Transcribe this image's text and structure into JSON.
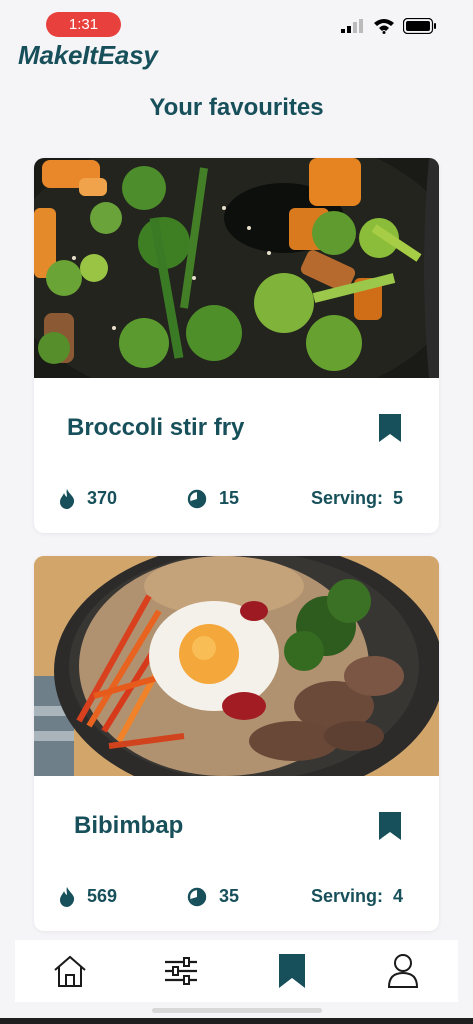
{
  "status_bar": {
    "time": "1:31"
  },
  "app": {
    "brand": "MakeItEasy"
  },
  "page": {
    "title": "Your favourites"
  },
  "recipes": [
    {
      "name": "Broccoli stir fry",
      "calories": "370",
      "time": "15",
      "serving_label": "Serving:",
      "serving": "5",
      "image": "broccoli-stir-fry-photo",
      "bookmarked": true
    },
    {
      "name": "Bibimbap",
      "calories": "569",
      "time": "35",
      "serving_label": "Serving:",
      "serving": "4",
      "image": "bibimbap-photo",
      "bookmarked": true
    }
  ],
  "bottom_nav": {
    "items": [
      {
        "icon": "home-icon",
        "active": false
      },
      {
        "icon": "filters-icon",
        "active": false
      },
      {
        "icon": "bookmark-icon",
        "active": true
      },
      {
        "icon": "profile-icon",
        "active": false
      }
    ]
  },
  "colors": {
    "primary": "#17505a",
    "time_pill": "#e8403c",
    "background": "#f5f4f7",
    "card": "#ffffff"
  }
}
